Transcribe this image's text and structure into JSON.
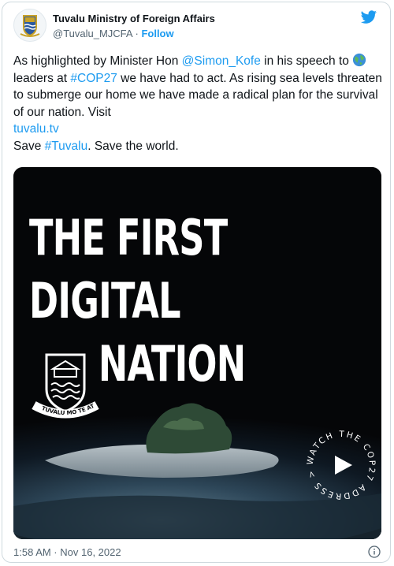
{
  "author": {
    "name": "Tuvalu Ministry of Foreign Affairs",
    "handle": "@Tuvalu_MJCFA",
    "separator": "·",
    "follow_label": "Follow"
  },
  "tweet": {
    "p1": "As highlighted by Minister Hon ",
    "mention": "@Simon_Kofe",
    "p2": " in his speech to ",
    "p3": " leaders at ",
    "hashtag1": "#COP27",
    "p4": " we have had to act. As rising sea levels threaten to submerge our home we have made a radical plan for the survival of our nation. Visit ",
    "url": "tuvalu.tv",
    "p5": "Save ",
    "hashtag2": "#Tuvalu",
    "p6": ". Save the world."
  },
  "media": {
    "headline_line1": "THE FIRST",
    "headline_line2": "DIGITAL",
    "headline_line3": "NATION",
    "crest_motto": "TUVALU MO TE ATUA",
    "watch_badge": "WATCH THE COP27 ADDRESS >>"
  },
  "footer": {
    "timestamp": "1:58 AM · Nov 16, 2022"
  },
  "colors": {
    "link": "#1d9bf0",
    "text": "#0f1419",
    "muted": "#536471"
  },
  "icons": [
    "twitter-bird-icon",
    "globe-icon",
    "play-icon",
    "info-icon"
  ]
}
